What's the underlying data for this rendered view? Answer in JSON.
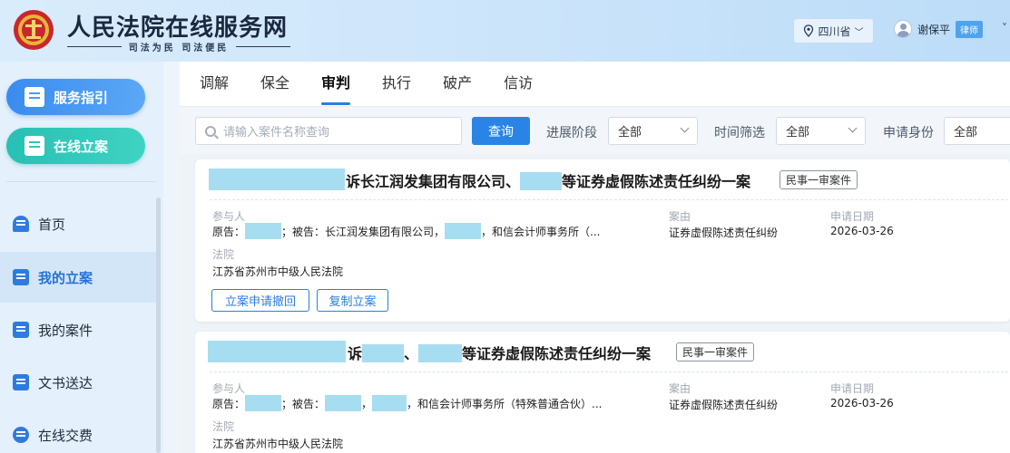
{
  "header": {
    "site_title": "人民法院在线服务网",
    "site_subtitle": "司法为民  司法便民",
    "region": "四川省",
    "user_name": "谢保平",
    "user_role": "律师",
    "emblem_icon": "court-emblem-icon",
    "location_icon": "location-pin-icon"
  },
  "sidebar": {
    "guide_button": "服务指引",
    "file_button": "在线立案",
    "items": [
      {
        "label": "首页",
        "icon": "home-icon"
      },
      {
        "label": "我的立案",
        "icon": "edit-icon"
      },
      {
        "label": "我的案件",
        "icon": "clipboard-icon"
      },
      {
        "label": "文书送达",
        "icon": "monitor-icon"
      },
      {
        "label": "在线交费",
        "icon": "payment-icon"
      }
    ]
  },
  "tabs": [
    "调解",
    "保全",
    "审判",
    "执行",
    "破产",
    "信访"
  ],
  "active_tab": "审判",
  "filters": {
    "search_placeholder": "请输入案件名称查询",
    "query_button": "查询",
    "stage_label": "进展阶段",
    "stage_value": "全部",
    "time_label": "时间筛选",
    "time_value": "全部",
    "identity_label": "申请身份",
    "identity_value": "全部"
  },
  "cases": [
    {
      "title_prefix": "诉长江润发集团有限公司、",
      "title_suffix": "等证券虚假陈述责任纠纷一案",
      "badge": "民事一审案件",
      "party_label": "参与人",
      "party_plaintiff": "原告：",
      "party_middle": "；被告：长江润发集团有限公司，",
      "party_tail": "，和信会计师事务所（...",
      "cause_label": "案由",
      "cause_value": "证券虚假陈述责任纠纷",
      "date_label": "申请日期",
      "date_value": "2026-03-26",
      "court_label": "法院",
      "court_value": "江苏省苏州市中级人民法院",
      "actions": [
        "立案申请撤回",
        "复制立案"
      ]
    },
    {
      "title_prefix": "诉",
      "title_sep": "、",
      "title_suffix": "等证券虚假陈述责任纠纷一案",
      "badge": "民事一审案件",
      "party_label": "参与人",
      "party_plaintiff": "原告：",
      "party_middle": "；被告：",
      "party_comma": "，",
      "party_tail": "，和信会计师事务所（特殊普通合伙）...",
      "cause_label": "案由",
      "cause_value": "证券虚假陈述责任纠纷",
      "date_label": "申请日期",
      "date_value": "2026-03-26",
      "court_label": "法院",
      "court_value": "江苏省苏州市中级人民法院"
    }
  ],
  "colors": {
    "accent": "#2a84e6",
    "teal": "#28c0b4",
    "redaction": "#a7ddf0"
  }
}
